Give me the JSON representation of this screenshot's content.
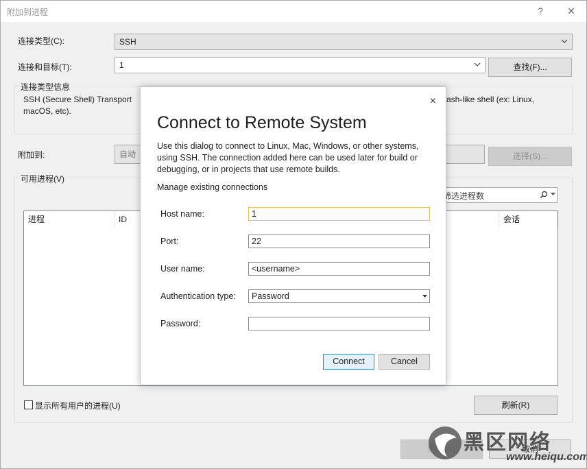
{
  "window": {
    "title": "附加到进程",
    "help_glyph": "?",
    "close_glyph": "✕"
  },
  "connection": {
    "type_label": "连接类型(C):",
    "type_value": "SSH",
    "target_label": "连接和目标(T):",
    "target_value": "1",
    "find_button": "查找(F)...",
    "info_group_title": "连接类型信息",
    "info_text_left": "SSH (Secure Shell) Transport",
    "info_text_right": "ash-like shell (ex: Linux,",
    "info_text_line2": "macOS, etc)."
  },
  "attach": {
    "label": "附加到:",
    "value": "自动",
    "select_button": "选择(S)..."
  },
  "processes": {
    "group_title": "可用进程(V)",
    "filter_placeholder": "筛选进程数",
    "columns": {
      "process": "进程",
      "id": "ID",
      "session": "会话"
    },
    "show_all_label": "显示所有用户的进程(U)",
    "refresh_button": "刷新(R)"
  },
  "footer": {
    "attach_button": "附加(A)",
    "cancel_button": "取消"
  },
  "dialog": {
    "close_glyph": "×",
    "title": "Connect to Remote System",
    "description": "Use this dialog to connect to Linux, Mac, Windows, or other systems, using SSH. The connection added here can be used later for build or debugging, or in projects that use remote builds.",
    "manage_link": "Manage existing connections",
    "fields": {
      "host_label": "Host name:",
      "host_value": "1",
      "port_label": "Port:",
      "port_value": "22",
      "user_label": "User name:",
      "user_value": "<username>",
      "auth_label": "Authentication type:",
      "auth_value": "Password",
      "password_label": "Password:",
      "password_value": ""
    },
    "connect_button": "Connect",
    "cancel_button": "Cancel"
  },
  "watermark": {
    "text": "黑区网络",
    "url": "www.heiqu.com"
  },
  "colors": {
    "window_bg": "#f0f0f0",
    "primary_border": "#3c7fb1",
    "focus_border": "#e5c365"
  }
}
